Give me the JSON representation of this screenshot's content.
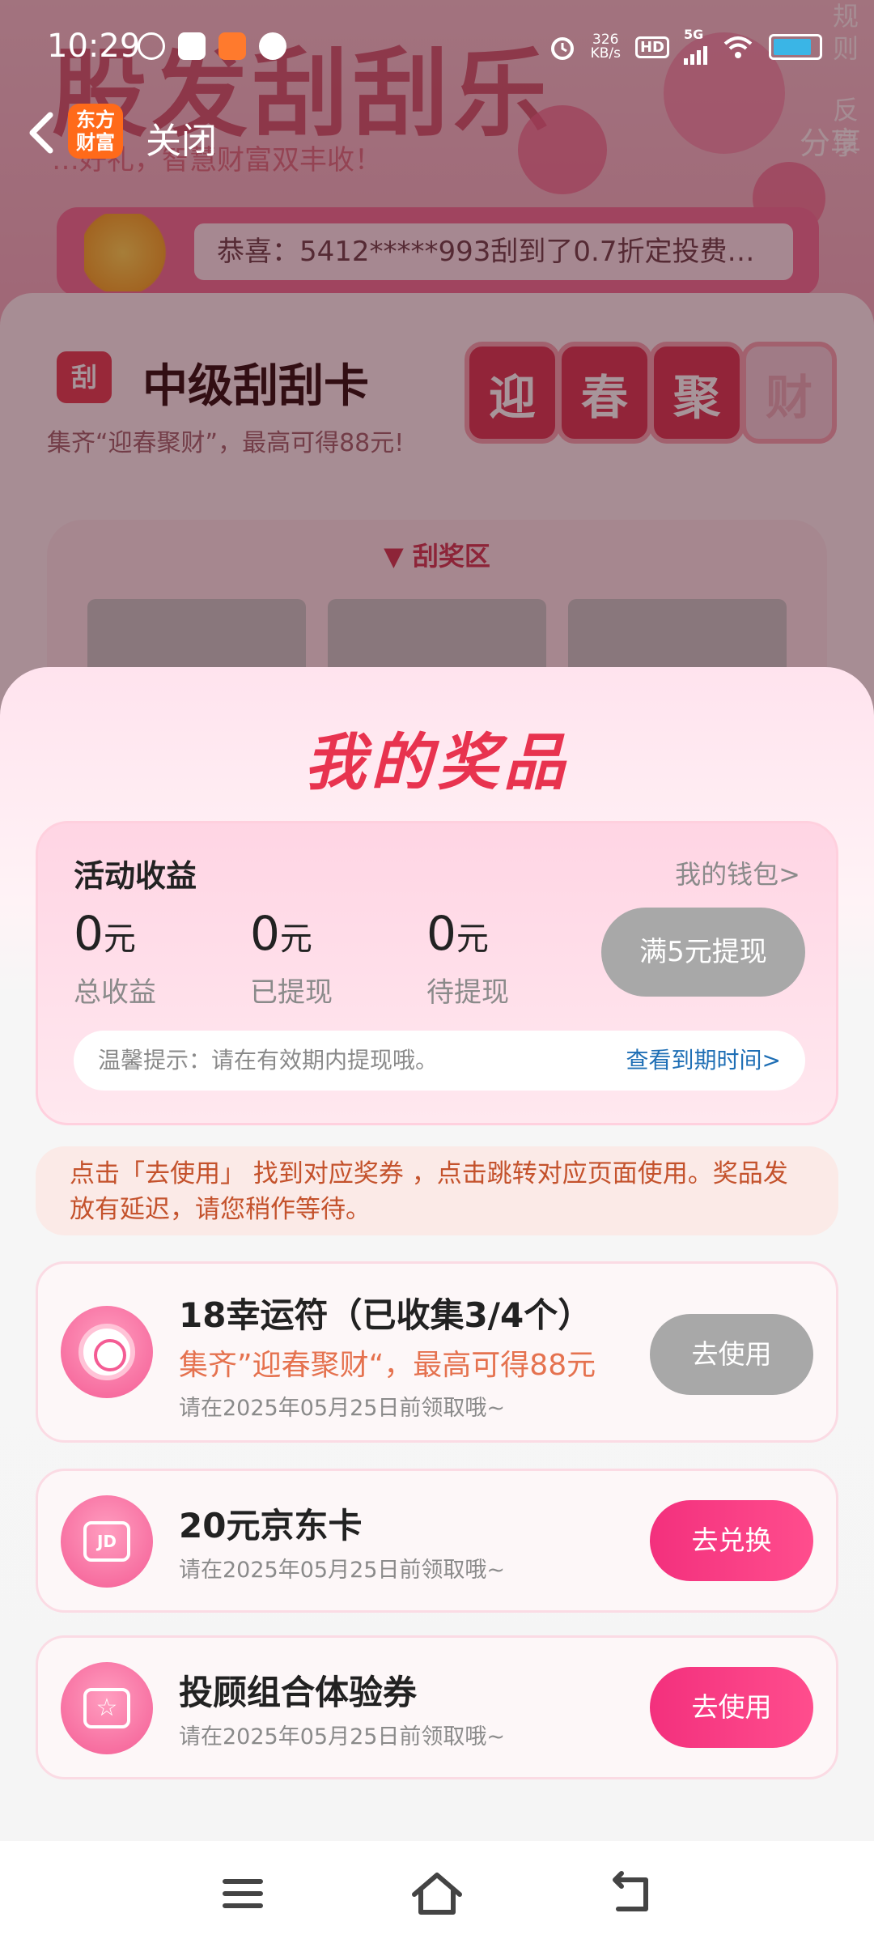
{
  "status_bar": {
    "time": "10:29",
    "net_speed_value": "326",
    "net_speed_unit": "KB/s",
    "hd_label": "HD",
    "network_type": "5G",
    "battery_level": 0.85
  },
  "background_page": {
    "title": "股发刮刮乐",
    "subtitle": "…好礼，智慧财富双丰收！",
    "side_links": [
      "规则",
      "反馈"
    ],
    "share_label": "分享",
    "notice_text": "恭喜：5412*****993刮到了0.7折定投费…",
    "card_badge": "刮",
    "card_title": "中级刮刮卡",
    "card_subtitle": "集齐“迎春聚财”，最高可得88元!",
    "chips": [
      "迎",
      "春",
      "聚",
      "财"
    ],
    "zone_label": "▼ 刮奖区"
  },
  "title_bar": {
    "logo_text": "东方财富",
    "close_label": "关闭"
  },
  "sheet": {
    "title": "我的奖品",
    "earnings": {
      "title": "活动收益",
      "wallet_link": "我的钱包>",
      "stats": [
        {
          "amount": "0",
          "unit": "元",
          "label": "总收益"
        },
        {
          "amount": "0",
          "unit": "元",
          "label": "已提现"
        },
        {
          "amount": "0",
          "unit": "元",
          "label": "待提现"
        }
      ],
      "withdraw_button": "满5元提现",
      "tip_text": "温馨提示：请在有效期内提现哦。",
      "tip_link": "查看到期时间>"
    },
    "hint": "点击「去使用」 找到对应奖券 ，点击跳转对应页面使用。奖品发放有延迟，请您稍作等待。",
    "prizes": [
      {
        "name": "18幸运符（已收集3/4个）",
        "desc": "集齐”迎春聚财“，最高可得88元",
        "date": "请在2025年05月25日前领取哦~",
        "button": "去使用",
        "button_state": "disabled",
        "icon": "lucky-charm-icon"
      },
      {
        "name": "20元京东卡",
        "desc": "",
        "date": "请在2025年05月25日前领取哦~",
        "button": "去兑换",
        "button_state": "active",
        "icon": "jd-card-icon",
        "icon_text": "JD"
      },
      {
        "name": "投顾组合体验券",
        "desc": "",
        "date": "请在2025年05月25日前领取哦~",
        "button": "去使用",
        "button_state": "active",
        "icon": "star-ticket-icon",
        "icon_text": "☆"
      }
    ]
  },
  "nav_bar": {
    "items": [
      "menu-icon",
      "home-icon",
      "back-icon"
    ]
  },
  "colors": {
    "accent": "#e8334f",
    "button_pink": "#f3307d",
    "button_gray": "#a8a8a8",
    "link_blue": "#1f6fb5"
  }
}
